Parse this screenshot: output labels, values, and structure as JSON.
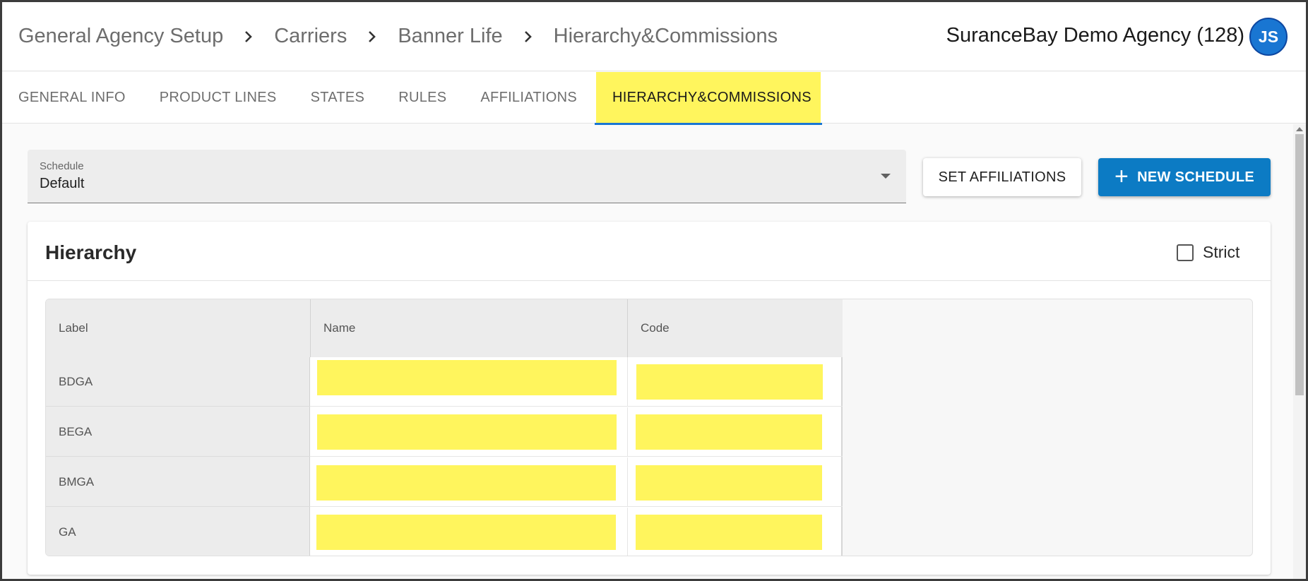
{
  "breadcrumb": [
    {
      "label": "General Agency Setup"
    },
    {
      "label": "Carriers"
    },
    {
      "label": "Banner Life"
    },
    {
      "label": "Hierarchy&Commissions"
    }
  ],
  "agency_name": "SuranceBay Demo Agency (128)",
  "user_initials": "JS",
  "tabs": [
    {
      "label": "GENERAL INFO"
    },
    {
      "label": "PRODUCT LINES"
    },
    {
      "label": "STATES"
    },
    {
      "label": "RULES"
    },
    {
      "label": "AFFILIATIONS"
    },
    {
      "label": "HIERARCHY&COMMISSIONS",
      "active": true
    }
  ],
  "schedule": {
    "label": "Schedule",
    "value": "Default"
  },
  "buttons": {
    "set_affiliations": "SET AFFILIATIONS",
    "new_schedule": "NEW SCHEDULE"
  },
  "hierarchy": {
    "title": "Hierarchy",
    "strict_label": "Strict",
    "strict_checked": false,
    "columns": [
      "Label",
      "Name",
      "Code"
    ],
    "rows": [
      {
        "label": "BDGA",
        "name": "",
        "code": ""
      },
      {
        "label": "BEGA",
        "name": "",
        "code": ""
      },
      {
        "label": "BMGA",
        "name": "",
        "code": ""
      },
      {
        "label": "GA",
        "name": "",
        "code": ""
      }
    ]
  },
  "colors": {
    "accent": "#0c7bc4",
    "highlight": "#fff55d",
    "avatar": "#1976d2"
  },
  "icons": {
    "separator": "chevron-right-icon",
    "dropdown": "caret-down-icon",
    "add": "plus-icon"
  }
}
